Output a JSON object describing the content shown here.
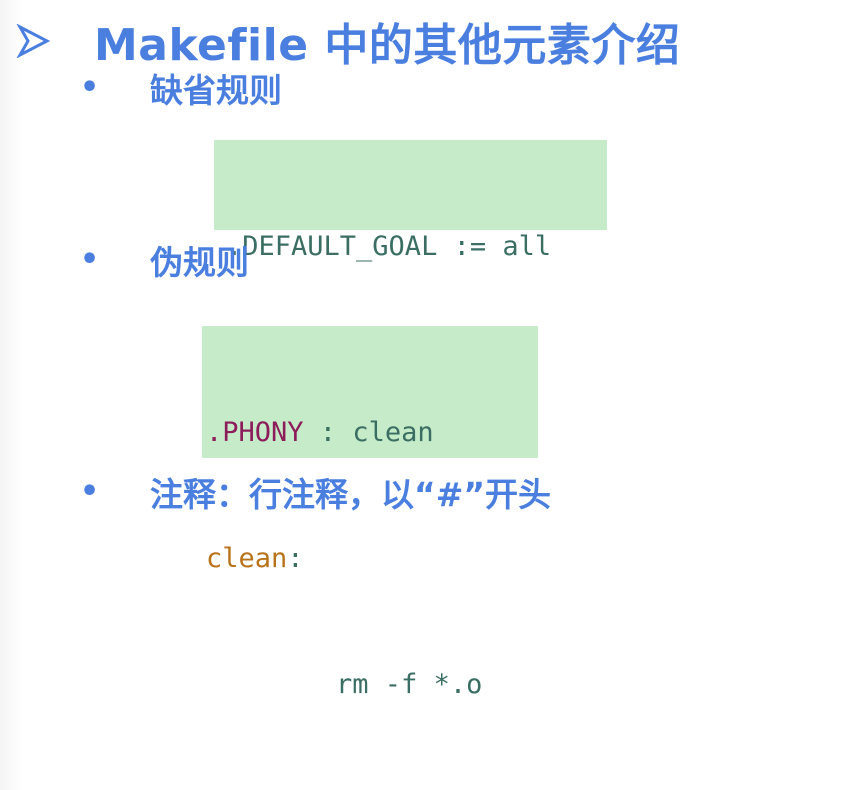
{
  "slide": {
    "title": "Makefile 中的其他元素介绍",
    "bullets": [
      {
        "marker": "•",
        "text": "缺省规则"
      },
      {
        "marker": "•",
        "text": "伪规则"
      },
      {
        "marker": "•",
        "text": "注释：行注释，以“#”开头"
      }
    ],
    "code_blocks": {
      "default_goal": {
        "line1": ".DEFAULT_GOAL := all",
        "line2_target": "all",
        "line2_rest": " :"
      },
      "phony": {
        "line1_target": ".PHONY",
        "line1_rest": " : clean",
        "line2_target": "clean",
        "line2_rest": ":",
        "line3": "        rm -f *.o"
      }
    },
    "colors": {
      "heading": "#4a7fe0",
      "code_bg": "#c6ebc9",
      "code_text": "#3b6e63",
      "code_target": "#b8731b",
      "code_phony": "#8c1c5a"
    },
    "icons": {
      "title_marker": "arrow-right-outline-icon"
    }
  }
}
